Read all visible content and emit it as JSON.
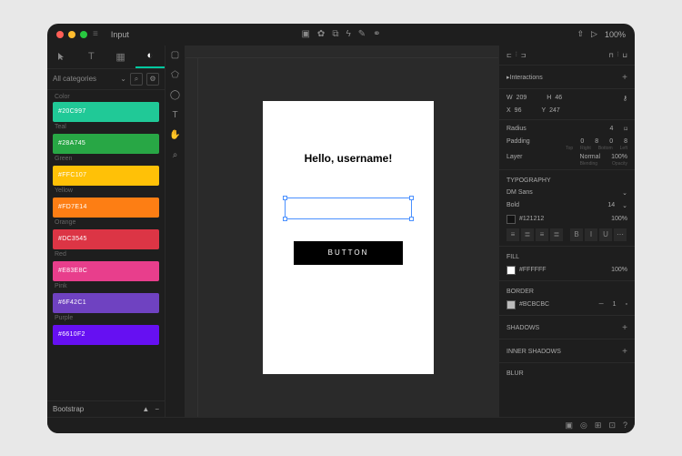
{
  "titlebar": {
    "title": "Input",
    "zoom": "100%"
  },
  "sidebar": {
    "category_label": "All categories",
    "palette_header": "Color",
    "colors": [
      {
        "hex": "#20C997",
        "code": "#20C997",
        "name": "Teal"
      },
      {
        "hex": "#28a745",
        "code": "#28A745",
        "name": "Green"
      },
      {
        "hex": "#ffc107",
        "code": "#FFC107",
        "name": "Yellow"
      },
      {
        "hex": "#fd7e14",
        "code": "#FD7E14",
        "name": "Orange"
      },
      {
        "hex": "#dc3545",
        "code": "#DC3545",
        "name": "Red"
      },
      {
        "hex": "#e83e8c",
        "code": "#E83E8C",
        "name": "Pink"
      },
      {
        "hex": "#6f42c1",
        "code": "#6F42C1",
        "name": "Purple"
      },
      {
        "hex": "#6610f2",
        "code": "#6610F2",
        "name": ""
      }
    ],
    "footer_label": "Bootstrap"
  },
  "canvas": {
    "heading": "Hello, username!",
    "button": "BUTTON"
  },
  "panel": {
    "interactions": "Interactions",
    "w_label": "W",
    "w": "209",
    "h_label": "H",
    "h": "46",
    "x_label": "X",
    "x": "96",
    "y_label": "Y",
    "y": "247",
    "radius_label": "Radius",
    "radius": "4",
    "padding_label": "Padding",
    "padding": [
      "0",
      "8",
      "0",
      "8"
    ],
    "padding_captions": [
      "Top",
      "Right",
      "Bottom",
      "Left"
    ],
    "layer_label": "Layer",
    "blend": "Normal",
    "opacity_layer": "100%",
    "layer_captions": [
      "Blending",
      "Opacity"
    ],
    "typography": "TYPOGRAPHY",
    "font": "DM Sans",
    "weight": "Bold",
    "size": "14",
    "text_color": "#121212",
    "text_opacity": "100%",
    "fill": "FILL",
    "fill_color": "#FFFFFF",
    "fill_opacity": "100%",
    "border": "BORDER",
    "border_color": "#BCBCBC",
    "border_width": "1",
    "shadows": "SHADOWS",
    "inner_shadows": "INNER SHADOWS",
    "blur": "BLUR"
  }
}
